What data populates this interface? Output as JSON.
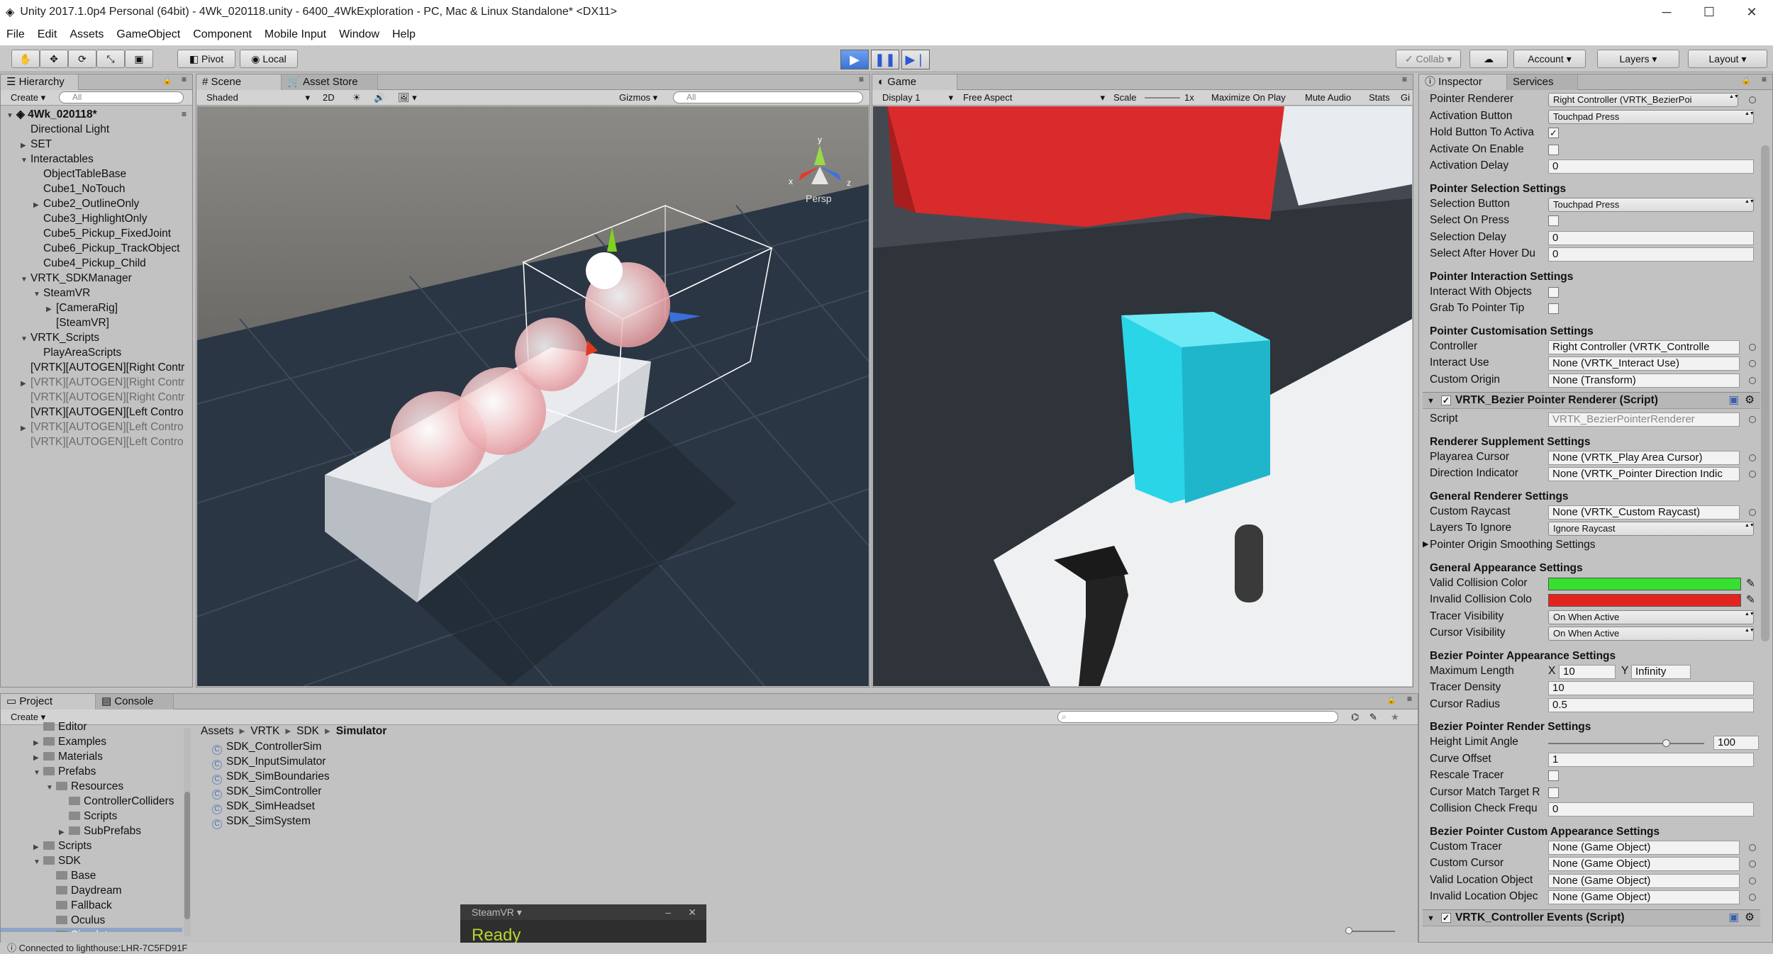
{
  "window": {
    "title": "Unity 2017.1.0p4 Personal (64bit) - 4Wk_020118.unity - 6400_4WkExploration - PC, Mac & Linux Standalone* <DX11>",
    "minimize": "─",
    "maximize": "☐",
    "close": "✕"
  },
  "menu": [
    "File",
    "Edit",
    "Assets",
    "GameObject",
    "Component",
    "Mobile Input",
    "Window",
    "Help"
  ],
  "toolbar": {
    "pivot": "Pivot",
    "local": "Local",
    "collab": "Collab ▾",
    "account": "Account",
    "layers": "Layers",
    "layout": "Layout"
  },
  "hierarchy": {
    "tab": "Hierarchy",
    "create": "Create ▾",
    "search": "All",
    "scene_name": "4Wk_020118*",
    "items": [
      {
        "label": "Directional Light",
        "indent": 1,
        "arrow": "",
        "grey": false
      },
      {
        "label": "SET",
        "indent": 1,
        "arrow": "▶",
        "grey": false
      },
      {
        "label": "Interactables",
        "indent": 1,
        "arrow": "▼",
        "grey": false
      },
      {
        "label": "ObjectTableBase",
        "indent": 2,
        "arrow": "",
        "grey": false
      },
      {
        "label": "Cube1_NoTouch",
        "indent": 2,
        "arrow": "",
        "grey": false
      },
      {
        "label": "Cube2_OutlineOnly",
        "indent": 2,
        "arrow": "▶",
        "grey": false
      },
      {
        "label": "Cube3_HighlightOnly",
        "indent": 2,
        "arrow": "",
        "grey": false
      },
      {
        "label": "Cube5_Pickup_FixedJoint",
        "indent": 2,
        "arrow": "",
        "grey": false
      },
      {
        "label": "Cube6_Pickup_TrackObject",
        "indent": 2,
        "arrow": "",
        "grey": false
      },
      {
        "label": "Cube4_Pickup_Child",
        "indent": 2,
        "arrow": "",
        "grey": false
      },
      {
        "label": "VRTK_SDKManager",
        "indent": 1,
        "arrow": "▼",
        "grey": false
      },
      {
        "label": "SteamVR",
        "indent": 2,
        "arrow": "▼",
        "grey": false
      },
      {
        "label": "[CameraRig]",
        "indent": 3,
        "arrow": "▶",
        "grey": false
      },
      {
        "label": "[SteamVR]",
        "indent": 3,
        "arrow": "",
        "grey": false
      },
      {
        "label": "VRTK_Scripts",
        "indent": 1,
        "arrow": "▼",
        "grey": false
      },
      {
        "label": "PlayAreaScripts",
        "indent": 2,
        "arrow": "",
        "grey": false
      },
      {
        "label": "[VRTK][AUTOGEN][Right Contr",
        "indent": 1,
        "arrow": "",
        "grey": false
      },
      {
        "label": "[VRTK][AUTOGEN][Right Contr",
        "indent": 1,
        "arrow": "▶",
        "grey": true
      },
      {
        "label": "[VRTK][AUTOGEN][Right Contr",
        "indent": 1,
        "arrow": "",
        "grey": true
      },
      {
        "label": "[VRTK][AUTOGEN][Left Contro",
        "indent": 1,
        "arrow": "",
        "grey": false
      },
      {
        "label": "[VRTK][AUTOGEN][Left Contro",
        "indent": 1,
        "arrow": "▶",
        "grey": true
      },
      {
        "label": "[VRTK][AUTOGEN][Left Contro",
        "indent": 1,
        "arrow": "",
        "grey": true
      }
    ]
  },
  "scene": {
    "tab": "Scene",
    "asset_store": "Asset Store",
    "shaded": "Shaded",
    "mode2d": "2D",
    "gizmos": "Gizmos",
    "search": "All",
    "persp": "Persp",
    "axis_y": "y",
    "axis_x": "x",
    "axis_z": "z"
  },
  "game": {
    "tab": "Game",
    "display": "Display 1",
    "aspect": "Free Aspect",
    "scale_label": "Scale",
    "scale_value": "1x",
    "maximize": "Maximize On Play",
    "mute": "Mute Audio",
    "stats": "Stats",
    "gizmos": "Gi"
  },
  "inspector": {
    "tab": "Inspector",
    "services": "Services",
    "rows": [
      {
        "type": "drop",
        "label": "Pointer Renderer",
        "value": "Right Controller (VRTK_BezierPoi",
        "dot": true
      },
      {
        "type": "drop",
        "label": "Activation Button",
        "value": "Touchpad Press"
      },
      {
        "type": "check",
        "label": "Hold Button To Activa",
        "checked": true
      },
      {
        "type": "check",
        "label": "Activate On Enable",
        "checked": false
      },
      {
        "type": "field",
        "label": "Activation Delay",
        "value": "0"
      },
      {
        "type": "header",
        "label": "Pointer Selection Settings"
      },
      {
        "type": "drop",
        "label": "Selection Button",
        "value": "Touchpad Press"
      },
      {
        "type": "check",
        "label": "Select On Press",
        "checked": false
      },
      {
        "type": "field",
        "label": "Selection Delay",
        "value": "0"
      },
      {
        "type": "field",
        "label": "Select After Hover Du",
        "value": "0"
      },
      {
        "type": "header",
        "label": "Pointer Interaction Settings"
      },
      {
        "type": "check",
        "label": "Interact With Objects",
        "checked": false
      },
      {
        "type": "check",
        "label": "Grab To Pointer Tip",
        "checked": false
      },
      {
        "type": "header",
        "label": "Pointer Customisation Settings"
      },
      {
        "type": "field",
        "label": "Controller",
        "value": "Right Controller (VRTK_Controlle",
        "dot": true
      },
      {
        "type": "field",
        "label": "Interact Use",
        "value": "None (VRTK_Interact Use)",
        "dot": true
      },
      {
        "type": "field",
        "label": "Custom Origin",
        "value": "None (Transform)",
        "dot": true
      },
      {
        "type": "component",
        "label": "VRTK_Bezier Pointer Renderer (Script)"
      },
      {
        "type": "field",
        "label": "Script",
        "value": "VRTK_BezierPointerRenderer",
        "dot": true,
        "disabled": true
      },
      {
        "type": "header",
        "label": "Renderer Supplement Settings"
      },
      {
        "type": "field",
        "label": "Playarea Cursor",
        "value": "None (VRTK_Play Area Cursor)",
        "dot": true
      },
      {
        "type": "field",
        "label": "Direction Indicator",
        "value": "None (VRTK_Pointer Direction Indic",
        "dot": true
      },
      {
        "type": "header",
        "label": "General Renderer Settings"
      },
      {
        "type": "field",
        "label": "Custom Raycast",
        "value": "None (VRTK_Custom Raycast)",
        "dot": true
      },
      {
        "type": "drop",
        "label": "Layers To Ignore",
        "value": "Ignore Raycast"
      },
      {
        "type": "fold",
        "label": "Pointer Origin Smoothing Settings"
      },
      {
        "type": "header",
        "label": "General Appearance Settings"
      },
      {
        "type": "color",
        "label": "Valid Collision Color",
        "value": "#35e02e"
      },
      {
        "type": "color",
        "label": "Invalid Collision Colo",
        "value": "#e3241e"
      },
      {
        "type": "drop",
        "label": "Tracer Visibility",
        "value": "On When Active"
      },
      {
        "type": "drop",
        "label": "Cursor Visibility",
        "value": "On When Active"
      },
      {
        "type": "header",
        "label": "Bezier Pointer Appearance Settings"
      },
      {
        "type": "xy",
        "label": "Maximum Length",
        "x_label": "X",
        "x": "10",
        "y_label": "Y",
        "y": "Infinity"
      },
      {
        "type": "field",
        "label": "Tracer Density",
        "value": "10"
      },
      {
        "type": "field",
        "label": "Cursor Radius",
        "value": "0.5"
      },
      {
        "type": "header",
        "label": "Bezier Pointer Render Settings"
      },
      {
        "type": "slider",
        "label": "Height Limit Angle",
        "value": "100",
        "fraction": 0.73
      },
      {
        "type": "field",
        "label": "Curve Offset",
        "value": "1"
      },
      {
        "type": "check",
        "label": "Rescale Tracer",
        "checked": false
      },
      {
        "type": "check",
        "label": "Cursor Match Target R",
        "checked": false
      },
      {
        "type": "field",
        "label": "Collision Check Frequ",
        "value": "0"
      },
      {
        "type": "header",
        "label": "Bezier Pointer Custom Appearance Settings"
      },
      {
        "type": "field",
        "label": "Custom Tracer",
        "value": "None (Game Object)",
        "dot": true
      },
      {
        "type": "field",
        "label": "Custom Cursor",
        "value": "None (Game Object)",
        "dot": true
      },
      {
        "type": "field",
        "label": "Valid Location Object",
        "value": "None (Game Object)",
        "dot": true
      },
      {
        "type": "field",
        "label": "Invalid Location Objec",
        "value": "None (Game Object)",
        "dot": true
      },
      {
        "type": "component",
        "label": "VRTK_Controller Events (Script)"
      }
    ]
  },
  "project": {
    "tab": "Project",
    "console": "Console",
    "create": "Create ▾",
    "breadcrumb": [
      "Assets",
      "VRTK",
      "SDK",
      "Simulator"
    ],
    "tree": [
      {
        "label": "Editor",
        "indent": 2,
        "arrow": ""
      },
      {
        "label": "Examples",
        "indent": 2,
        "arrow": "▶"
      },
      {
        "label": "Materials",
        "indent": 2,
        "arrow": "▶"
      },
      {
        "label": "Prefabs",
        "indent": 2,
        "arrow": "▼"
      },
      {
        "label": "Resources",
        "indent": 3,
        "arrow": "▼"
      },
      {
        "label": "ControllerColliders",
        "indent": 4,
        "arrow": ""
      },
      {
        "label": "Scripts",
        "indent": 4,
        "arrow": ""
      },
      {
        "label": "SubPrefabs",
        "indent": 4,
        "arrow": "▶"
      },
      {
        "label": "Scripts",
        "indent": 2,
        "arrow": "▶"
      },
      {
        "label": "SDK",
        "indent": 2,
        "arrow": "▼"
      },
      {
        "label": "Base",
        "indent": 3,
        "arrow": ""
      },
      {
        "label": "Daydream",
        "indent": 3,
        "arrow": ""
      },
      {
        "label": "Fallback",
        "indent": 3,
        "arrow": ""
      },
      {
        "label": "Oculus",
        "indent": 3,
        "arrow": ""
      },
      {
        "label": "Simulator",
        "indent": 3,
        "arrow": "",
        "selected": true
      }
    ],
    "files": [
      "SDK_ControllerSim",
      "SDK_InputSimulator",
      "SDK_SimBoundaries",
      "SDK_SimController",
      "SDK_SimHeadset",
      "SDK_SimSystem"
    ]
  },
  "steamvr": {
    "title": "SteamVR ▾",
    "status": "Ready",
    "minimize": "–",
    "close": "✕"
  },
  "status": {
    "text": "Connected to lighthouse:LHR-7C5FD91F"
  }
}
